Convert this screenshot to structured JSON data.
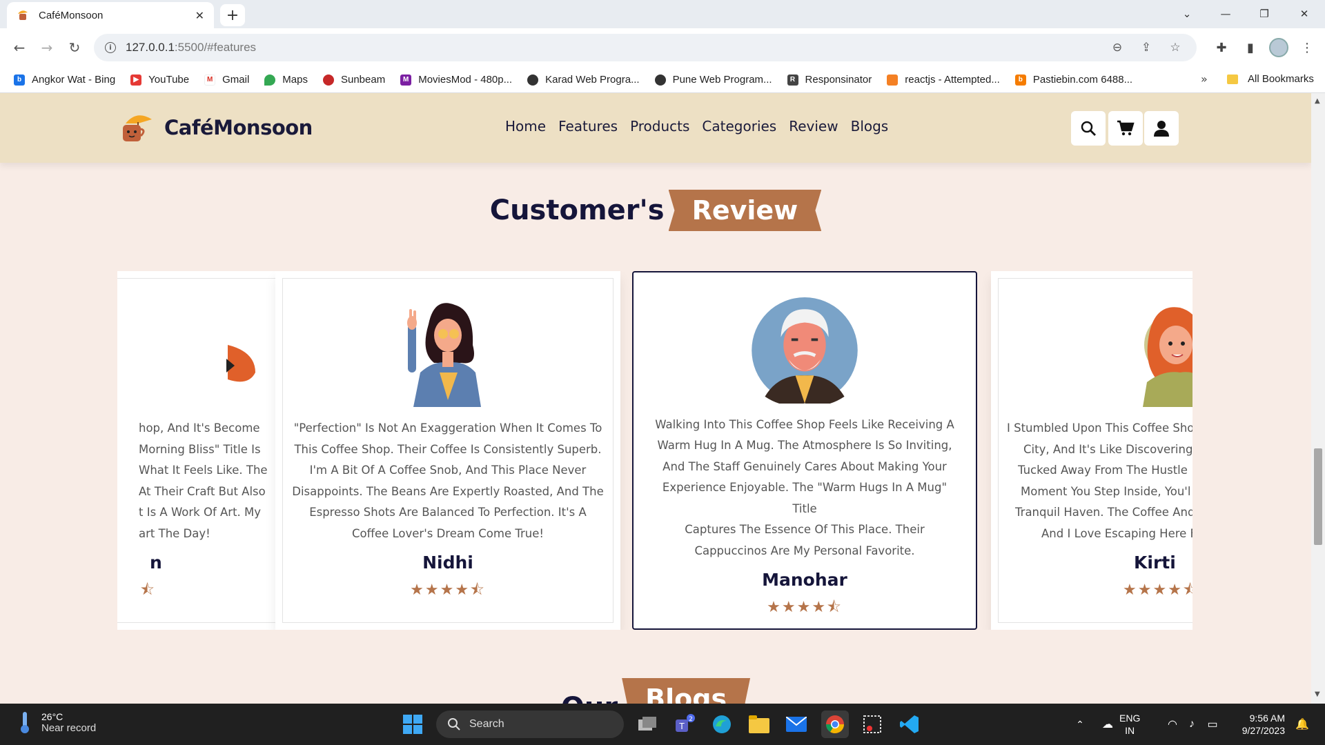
{
  "browser": {
    "tab_title": "CaféMonsoon",
    "url_host": "127.0.0.1",
    "url_rest": ":5500/#features",
    "bookmarks": [
      {
        "label": "Angkor Wat - Bing",
        "icon": "bing-icon",
        "color": "#1a73e8"
      },
      {
        "label": "YouTube",
        "icon": "youtube-icon",
        "color": "#e53935"
      },
      {
        "label": "Gmail",
        "icon": "gmail-icon",
        "color": "#d93025"
      },
      {
        "label": "Maps",
        "icon": "maps-icon",
        "color": "#34a853"
      },
      {
        "label": "Sunbeam",
        "icon": "sunbeam-icon",
        "color": "#c62828"
      },
      {
        "label": "MoviesMod - 480p...",
        "icon": "moviesmod-icon",
        "color": "#7b1fa2"
      },
      {
        "label": "Karad Web Progra...",
        "icon": "globe-icon",
        "color": "#333333"
      },
      {
        "label": "Pune Web Program...",
        "icon": "globe-icon",
        "color": "#333333"
      },
      {
        "label": "Responsinator",
        "icon": "responsinator-icon",
        "color": "#444444"
      },
      {
        "label": "reactjs - Attempted...",
        "icon": "stackoverflow-icon",
        "color": "#f48024"
      },
      {
        "label": "Pastiebin.com 6488...",
        "icon": "pastiebin-icon",
        "color": "#f57c00"
      }
    ],
    "all_bookmarks": "All Bookmarks",
    "more": "»"
  },
  "site": {
    "logo_text": "CaféMonsoon",
    "nav": [
      "Home",
      "Features",
      "Products",
      "Categories",
      "Review",
      "Blogs"
    ],
    "accent": "#b5744a",
    "dark": "#15153a",
    "header_bg": "#ede0c4",
    "page_bg": "#f8ece6"
  },
  "review_section": {
    "title_plain": "Customer's",
    "title_highlight": "Review",
    "cards": [
      {
        "name": "n",
        "text": "hop, And It's Become Morning Bliss\" Title Is What It Feels Like. The At Their Craft But Also t Is A Work Of Art. My art The Day!",
        "lines": [
          "hop, And It's Become",
          "Morning Bliss\" Title Is",
          "What It Feels Like. The",
          "At Their Craft But Also",
          "t Is A Work Of Art. My",
          "art The Day!"
        ],
        "rating": 4.5,
        "avatar": "orange-avatar"
      },
      {
        "name": "Nidhi",
        "text": "\"Perfection\" Is Not An Exaggeration When It Comes To This Coffee Shop. Their Coffee Is Consistently Superb. I'm A Bit Of A Coffee Snob, And This Place Never Disappoints. The Beans Are Expertly Roasted, And The Espresso Shots Are Balanced To Perfection. It's A Coffee Lover's Dream Come True!",
        "lines": [
          "\"Perfection\" Is Not An Exaggeration When It Comes To",
          "This Coffee Shop. Their Coffee Is Consistently Superb.",
          "I'm A Bit Of A Coffee Snob, And This Place Never",
          "Disappoints. The Beans Are Expertly Roasted, And The",
          "Espresso Shots Are Balanced To Perfection. It's A",
          "Coffee Lover's Dream Come True!"
        ],
        "rating": 4.5,
        "avatar": "woman-avatar"
      },
      {
        "name": "Manohar",
        "text": "Walking Into This Coffee Shop Feels Like Receiving A Warm Hug In A Mug. The Atmosphere Is So Inviting, And The Staff Genuinely Cares About Making Your Experience Enjoyable. The \"Warm Hugs In A Mug\" Title Captures The Essence Of This Place. Their Cappuccinos Are My Personal Favorite.",
        "lines": [
          "Walking Into This Coffee Shop Feels Like Receiving A",
          "Warm Hug In A Mug. The Atmosphere Is So Inviting,",
          "And The Staff Genuinely Cares About Making Your",
          "Experience Enjoyable. The \"Warm Hugs In A Mug\" Title",
          "Captures The Essence Of This Place. Their",
          "Cappuccinos Are My Personal Favorite."
        ],
        "rating": 4.5,
        "avatar": "old-man-avatar"
      },
      {
        "name": "Kirti",
        "text": "I Stumbled Upon This Coffee Sho City, And It's Like Discovering Tucked Away From The Hustle Moment You Step Inside, You'l Tranquil Haven. The Coffee And And I Love Escaping Here F",
        "lines": [
          "I Stumbled Upon This Coffee Sho",
          "City, And It's Like Discovering",
          "Tucked Away From The Hustle",
          "Moment You Step Inside, You'l",
          "Tranquil Haven. The Coffee And",
          "And I Love Escaping Here F"
        ],
        "rating": 4.5,
        "avatar": "red-hair-woman-avatar"
      }
    ]
  },
  "blogs_section": {
    "title_plain": "Our",
    "title_highlight": "Blogs"
  },
  "taskbar": {
    "temp": "26°C",
    "weather_desc": "Near record",
    "search_label": "Search",
    "teams_badge": "2",
    "lang_top": "ENG",
    "lang_bottom": "IN",
    "time": "9:56 AM",
    "date": "9/27/2023"
  }
}
